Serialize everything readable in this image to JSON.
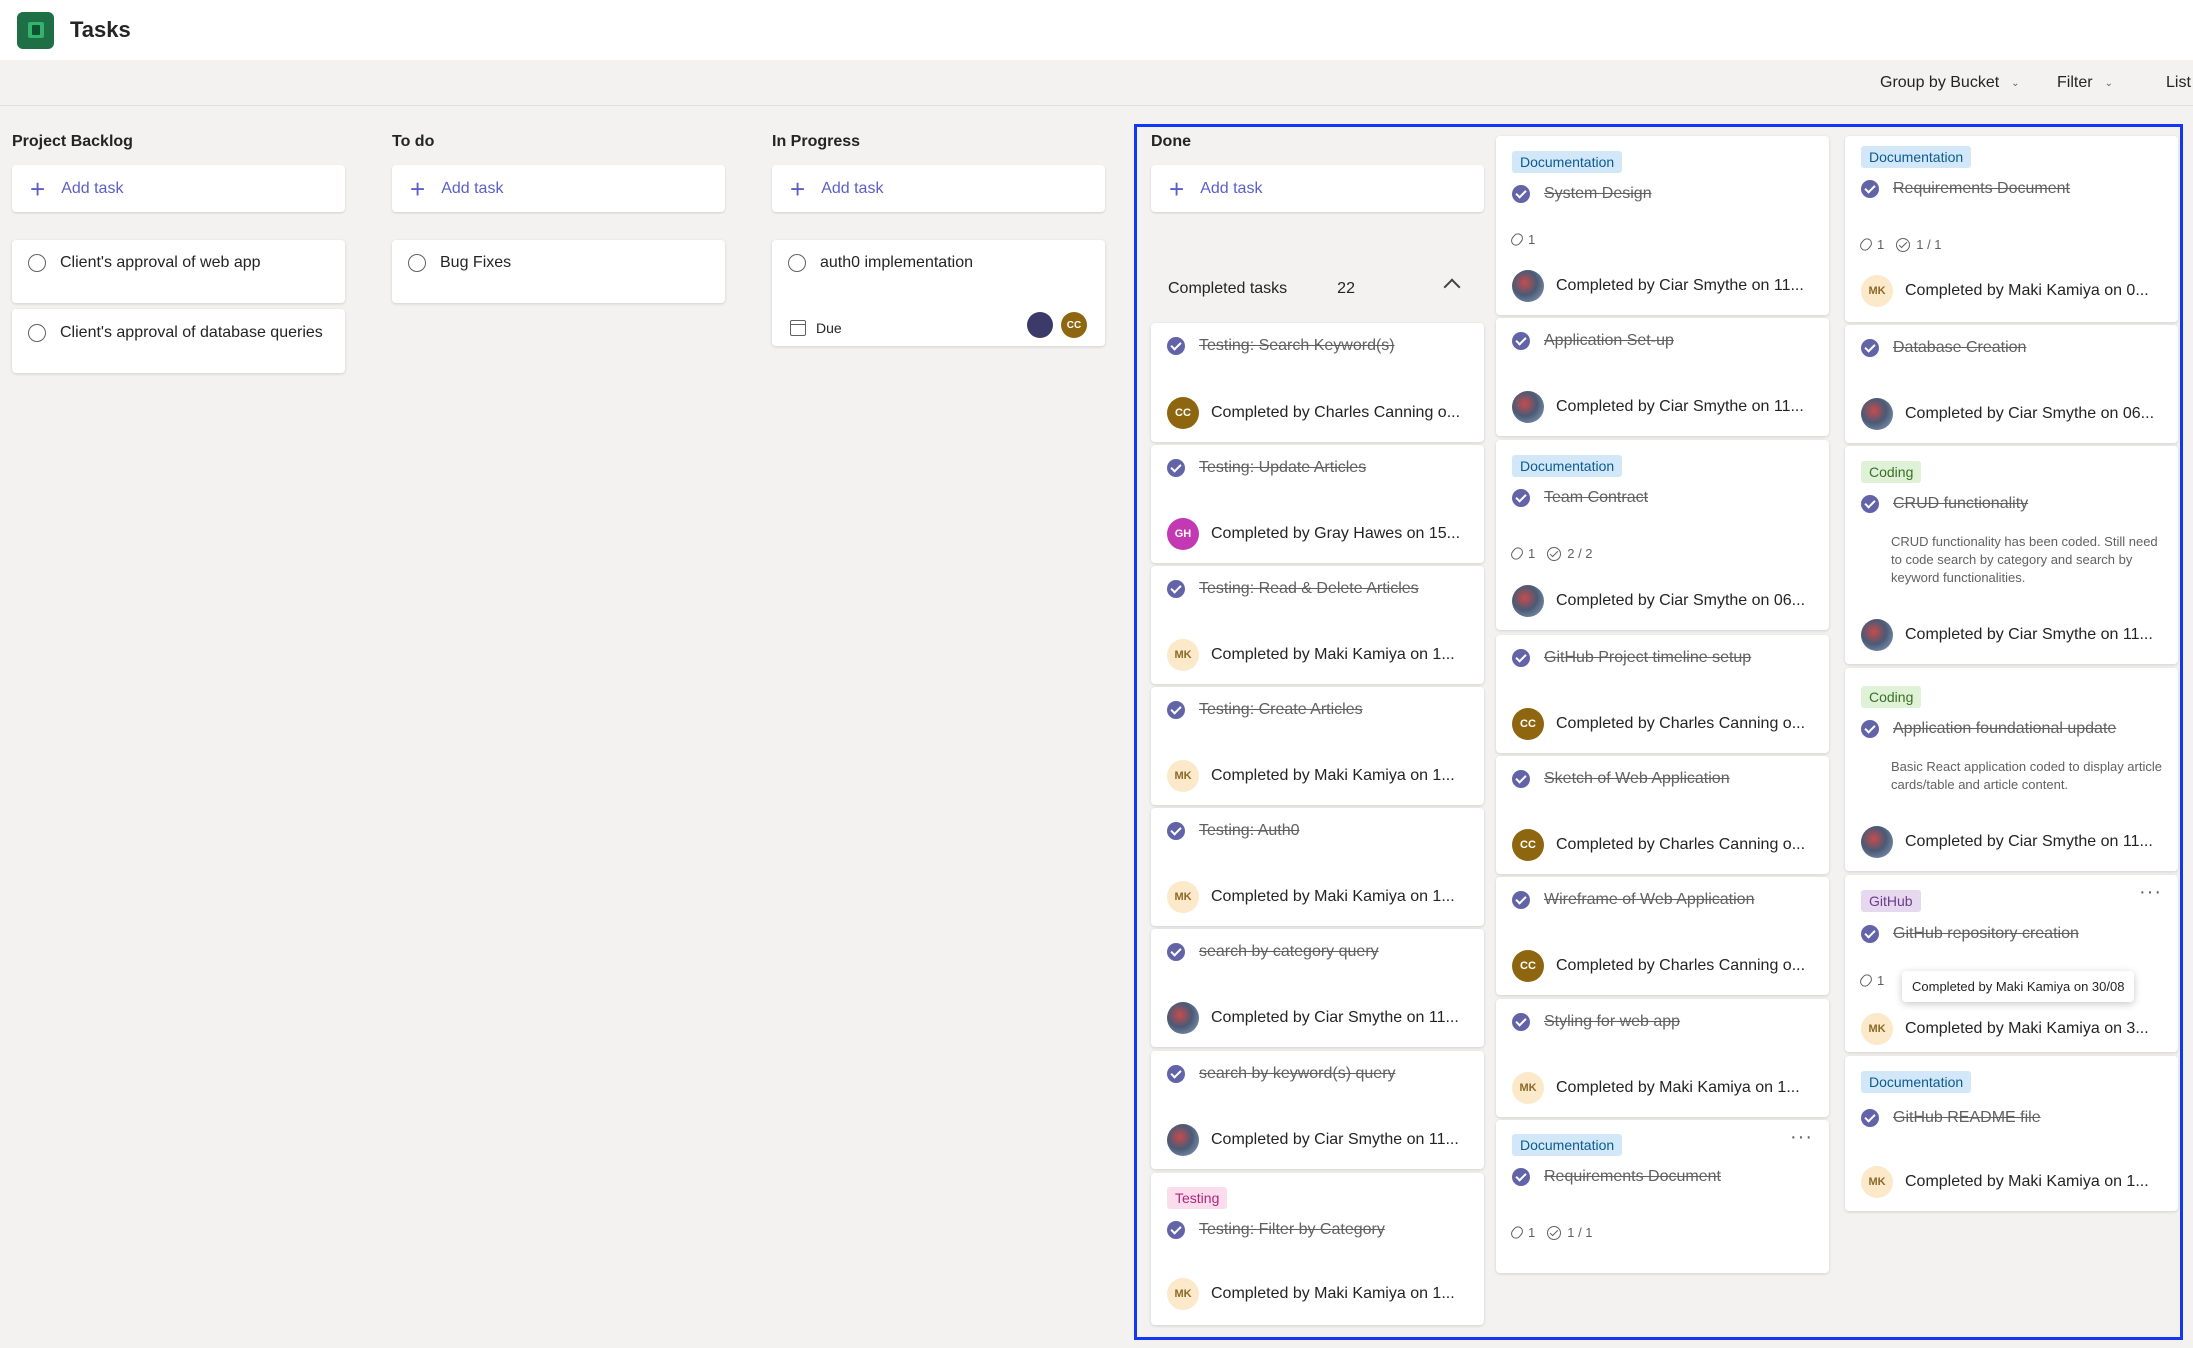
{
  "app": {
    "title": "Tasks"
  },
  "toolbar": {
    "group_by": "Group by Bucket",
    "filter": "Filter",
    "list": "List"
  },
  "columns": {
    "backlog": {
      "title": "Project Backlog",
      "add": "Add task",
      "tasks": [
        "Client's approval of web app",
        "Client's approval of database queries"
      ]
    },
    "todo": {
      "title": "To do",
      "add": "Add task",
      "tasks": [
        "Bug Fixes"
      ]
    },
    "progress": {
      "title": "In Progress",
      "add": "Add task",
      "task": "auth0 implementation",
      "due": "Due",
      "avatar_cc": "CC"
    },
    "done": {
      "title": "Done",
      "add": "Add task",
      "completed_label": "Completed tasks",
      "completed_count": "22"
    }
  },
  "done_col1": [
    {
      "task": "Testing: Search Keyword(s)",
      "initials": "CC",
      "by": "Completed by Charles Canning o..."
    },
    {
      "task": "Testing: Update Articles",
      "initials": "GH",
      "by": "Completed by Gray Hawes on 15..."
    },
    {
      "task": "Testing: Read & Delete Articles",
      "initials": "MK",
      "by": "Completed by Maki Kamiya on 1..."
    },
    {
      "task": "Testing: Create Articles",
      "initials": "MK",
      "by": "Completed by Maki Kamiya on 1..."
    },
    {
      "task": "Testing: Auth0",
      "initials": "MK",
      "by": "Completed by Maki Kamiya on 1..."
    },
    {
      "task": "search by category query",
      "initials": "",
      "by": "Completed by Ciar Smythe on 11..."
    },
    {
      "task": "search by keyword(s) query",
      "initials": "",
      "by": "Completed by Ciar Smythe on 11..."
    },
    {
      "label": "Testing",
      "task": "Testing: Filter by Category",
      "initials": "MK",
      "by": "Completed by Maki Kamiya on 1..."
    }
  ],
  "done_col2": [
    {
      "label": "Documentation",
      "task": "System Design",
      "attach": "1",
      "by": "Completed by Ciar Smythe on 11..."
    },
    {
      "task": "Application Set-up",
      "by": "Completed by Ciar Smythe on 11..."
    },
    {
      "label": "Documentation",
      "task": "Team Contract",
      "attach": "1",
      "check": "2 / 2",
      "by": "Completed by Ciar Smythe on 06..."
    },
    {
      "task": "GitHub Project timeline setup",
      "initials": "CC",
      "by": "Completed by Charles Canning o..."
    },
    {
      "task": "Sketch of Web Application",
      "initials": "CC",
      "by": "Completed by Charles Canning o..."
    },
    {
      "task": "Wireframe of Web Application",
      "initials": "CC",
      "by": "Completed by Charles Canning o..."
    },
    {
      "task": "Styling for web app",
      "initials": "MK",
      "by": "Completed by Maki Kamiya on 1..."
    },
    {
      "label": "Documentation",
      "task": "Requirements Document",
      "attach": "1",
      "check": "1 / 1"
    }
  ],
  "done_col3": [
    {
      "label": "Documentation",
      "task": "Requirements Document",
      "attach": "1",
      "check": "1 / 1",
      "initials": "MK",
      "by": "Completed by Maki Kamiya on 0..."
    },
    {
      "task": "Database Creation",
      "by": "Completed by Ciar Smythe on 06..."
    },
    {
      "label": "Coding",
      "task": "CRUD functionality",
      "desc": "CRUD functionality has been coded. Still need to code search by category and search by keyword functionalities.",
      "by": "Completed by Ciar Smythe on 11..."
    },
    {
      "label": "Coding",
      "task": "Application foundational update",
      "desc": "Basic React application coded to display article cards/table and article content.",
      "by": "Completed by Ciar Smythe on 11..."
    },
    {
      "label": "GitHub",
      "task": "GitHub repository creation",
      "attach": "1",
      "tooltip": "Completed by Maki Kamiya on 30/08",
      "initials": "MK",
      "by": "Completed by Maki Kamiya on 3..."
    },
    {
      "label": "Documentation",
      "task": "GitHub README file",
      "initials": "MK",
      "by": "Completed by Maki Kamiya on 1..."
    }
  ],
  "colors": {
    "accent": "#5b5fc7",
    "done_check": "#6264a7",
    "selection": "#1338f5"
  },
  "icons": {
    "app": "planner-icon",
    "add": "plus-icon",
    "chevron": "chevron-down-icon",
    "more": "more-icon"
  }
}
